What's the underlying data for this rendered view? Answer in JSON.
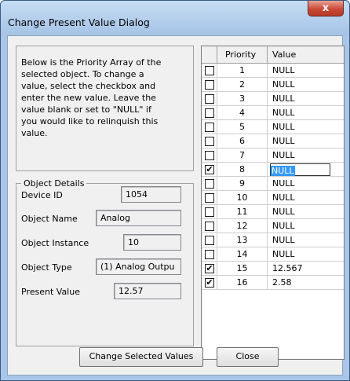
{
  "window": {
    "title": "Change Present Value Dialog",
    "close_glyph": "x"
  },
  "info_text": "Below is the Priority Array of the\nselected object. To change a\nvalue, select the checkbox and\nenter the new value. Leave the\nvalue blank or set to \"NULL\" if\nyou would like to relinquish this\nvalue.",
  "object_details": {
    "group_label": "Object Details",
    "device_id_label": "Device ID",
    "device_id": "1054",
    "object_name_label": "Object Name",
    "object_name": "Analog",
    "object_instance_label": "Object Instance",
    "object_instance": "10",
    "object_type_label": "Object Type",
    "object_type": "(1) Analog Outpu",
    "present_value_label": "Present Value",
    "present_value": "12.57"
  },
  "grid": {
    "headers": {
      "check": "",
      "priority": "Priority",
      "value": "Value"
    },
    "rows": [
      {
        "priority": "1",
        "value": "NULL",
        "checked": false
      },
      {
        "priority": "2",
        "value": "NULL",
        "checked": false
      },
      {
        "priority": "3",
        "value": "NULL",
        "checked": false
      },
      {
        "priority": "4",
        "value": "NULL",
        "checked": false
      },
      {
        "priority": "5",
        "value": "NULL",
        "checked": false
      },
      {
        "priority": "6",
        "value": "NULL",
        "checked": false
      },
      {
        "priority": "7",
        "value": "NULL",
        "checked": false
      },
      {
        "priority": "8",
        "value": "NULL",
        "checked": true,
        "editing": true
      },
      {
        "priority": "9",
        "value": "NULL",
        "checked": false
      },
      {
        "priority": "10",
        "value": "NULL",
        "checked": false
      },
      {
        "priority": "11",
        "value": "NULL",
        "checked": false
      },
      {
        "priority": "12",
        "value": "NULL",
        "checked": false
      },
      {
        "priority": "13",
        "value": "NULL",
        "checked": false
      },
      {
        "priority": "14",
        "value": "NULL",
        "checked": false
      },
      {
        "priority": "15",
        "value": "12.567",
        "checked": true
      },
      {
        "priority": "16",
        "value": "2.58",
        "checked": true
      }
    ]
  },
  "buttons": {
    "change_selected": "Change Selected Values",
    "close": "Close"
  },
  "check_glyph": "✔"
}
